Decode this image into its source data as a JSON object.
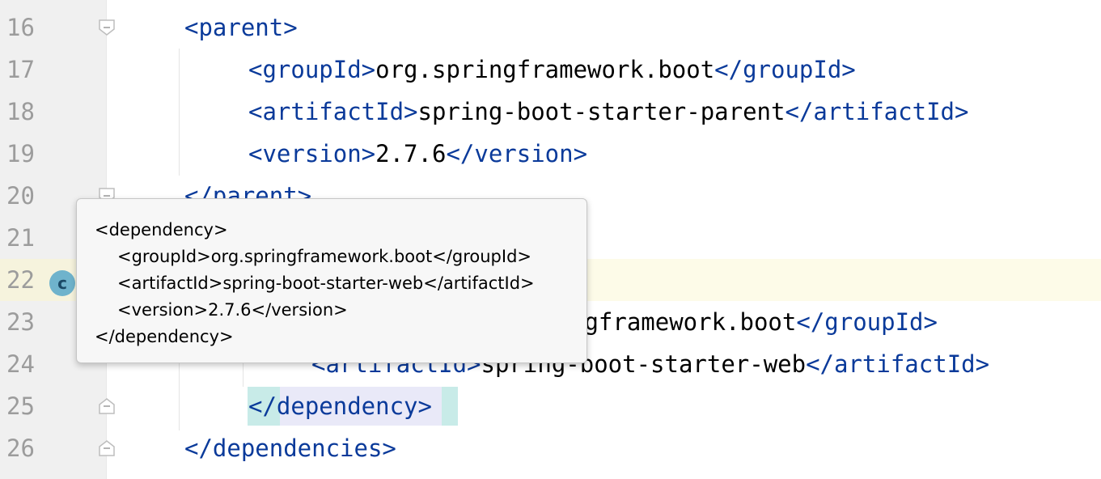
{
  "editor": {
    "lines": [
      {
        "num": "16",
        "tokens": [
          {
            "t": "tag",
            "v": "<parent>"
          }
        ]
      },
      {
        "num": "17",
        "tokens": [
          {
            "t": "tag",
            "v": "<groupId>"
          },
          {
            "t": "txt",
            "v": "org.springframework.boot"
          },
          {
            "t": "tag",
            "v": "</groupId>"
          }
        ]
      },
      {
        "num": "18",
        "tokens": [
          {
            "t": "tag",
            "v": "<artifactId>"
          },
          {
            "t": "txt",
            "v": "spring-boot-starter-parent"
          },
          {
            "t": "tag",
            "v": "</artifactId>"
          }
        ]
      },
      {
        "num": "19",
        "tokens": [
          {
            "t": "tag",
            "v": "<version>"
          },
          {
            "t": "txt",
            "v": "2.7.6"
          },
          {
            "t": "tag",
            "v": "</version>"
          }
        ]
      },
      {
        "num": "20",
        "tokens": [
          {
            "t": "tag",
            "v": "</parent>"
          }
        ]
      },
      {
        "num": "21",
        "tokens": []
      },
      {
        "num": "22",
        "tokens": []
      },
      {
        "num": "23",
        "tokens": [
          {
            "t": "txt",
            "v": "ngframework.boot"
          },
          {
            "t": "tag",
            "v": "</groupId>"
          }
        ]
      },
      {
        "num": "24",
        "tokens": [
          {
            "t": "tag",
            "v": "<artifactId>"
          },
          {
            "t": "txt",
            "v": "spring-boot-starter-web"
          },
          {
            "t": "tag",
            "v": "</artifactId>"
          }
        ]
      },
      {
        "num": "25",
        "tokens": [
          {
            "t": "tag",
            "v": "</dependency>"
          }
        ]
      },
      {
        "num": "26",
        "tokens": [
          {
            "t": "tag",
            "v": "</dependencies>"
          }
        ]
      }
    ]
  },
  "tooltip": {
    "lines": [
      "<dependency>",
      "<groupId>org.springframework.boot</groupId>",
      "<artifactId>spring-boot-starter-web</artifactId>",
      "<version>2.7.6</version>",
      "</dependency>"
    ]
  },
  "gutter_icon": {
    "name": "spring-bean-icon",
    "letter": "c"
  },
  "colors": {
    "tag": "#0a3a9a",
    "text": "#000000",
    "line_number": "#9c9c9c",
    "highlight_line": "#fdfbe8"
  }
}
